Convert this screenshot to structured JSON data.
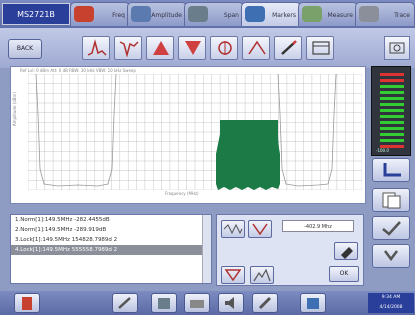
{
  "app": {
    "title": "MS2721B"
  },
  "tabs": [
    {
      "label": "Freq",
      "icon": "antenna-icon",
      "icon_color": "#c8412f"
    },
    {
      "label": "Amplitude",
      "icon": "satellite-icon",
      "icon_color": "#5a7ab0"
    },
    {
      "label": "Span",
      "icon": "probe-icon",
      "icon_color": "#6a7d8a"
    },
    {
      "label": "Markers",
      "icon": "spiral-icon",
      "icon_color": "#3d6fb2",
      "active": true
    },
    {
      "label": "Measure",
      "icon": "map-icon",
      "icon_color": "#7ba16a"
    },
    {
      "label": "Trace",
      "icon": "wrench-icon",
      "icon_color": "#8a8f99"
    }
  ],
  "toolbar": {
    "back_label": "BACK",
    "tools": [
      "peak-icon",
      "valley-icon",
      "marker-up-icon",
      "marker-down-icon",
      "center-icon",
      "delta-icon",
      "pencil-icon",
      "window-icon"
    ]
  },
  "spectrum": {
    "header": "Ref Lvl: 0 dBm   Att: 0 dB   RBW: 30 kHz   VBW: 10 kHz   Sweep",
    "ylabel": "Amplitude (dBm)",
    "xlabel": "Frequency (MHz)",
    "trace_color": "#1b7a45",
    "grid_color": "#b8b8b8"
  },
  "meter": {
    "value": "-100.0"
  },
  "markers": [
    {
      "text": "1.Norm[1]:149.5MHz    -282.4455dB"
    },
    {
      "text": "2.Norm[1]:149.5MHz    -289.919dB"
    },
    {
      "text": "3.Lock[1]:149.5MHz    154828.7989d 2"
    },
    {
      "text": "4.Lock[1]:149.5MHz    555558.7989d 2",
      "selected": true
    }
  ],
  "marker_panel": {
    "freq": "-402.9 Mhz",
    "ok_label": "OK"
  },
  "clock": {
    "line1": "9:34 AM",
    "line2": "4/14/2008"
  },
  "colors": {
    "accent": "#2a3f9a",
    "trace": "#1b7a45",
    "panel": "#8e9cc4"
  }
}
